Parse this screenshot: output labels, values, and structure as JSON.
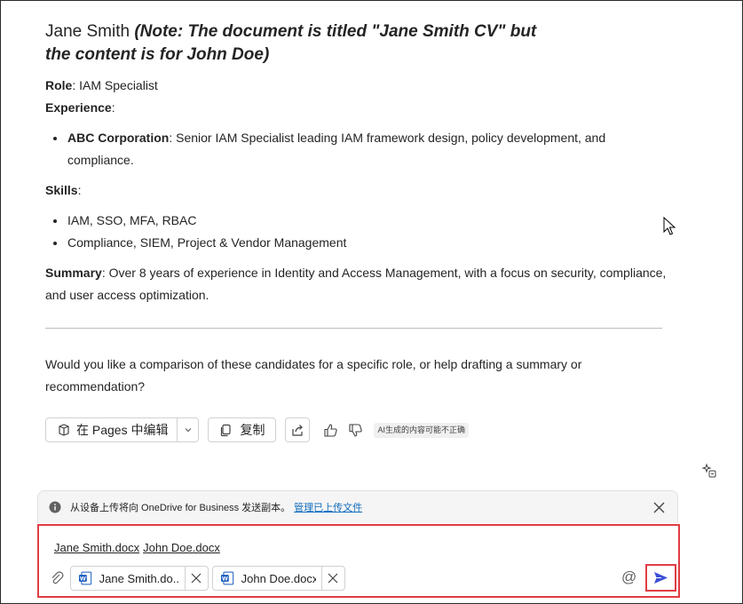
{
  "response": {
    "heading_name": "Jane Smith ",
    "heading_note": "(Note: The document is titled \"Jane Smith CV\" but the content is for John Doe)",
    "role_label": "Role",
    "role_value": ": IAM Specialist",
    "experience_label": "Experience",
    "experience_suffix": ":",
    "experience_items": [
      {
        "company": "ABC Corporation",
        "desc": ": Senior IAM Specialist leading IAM framework design, policy development, and compliance."
      }
    ],
    "skills_label": "Skills",
    "skills_suffix": ":",
    "skills_items": [
      "IAM, SSO, MFA, RBAC",
      "Compliance, SIEM, Project & Vendor Management"
    ],
    "summary_label": "Summary",
    "summary_value": ": Over 8 years of experience in Identity and Access Management, with a focus on security, compliance, and user access optimization.",
    "followup": "Would you like a comparison of these candidates for a specific role, or help drafting a summary or recommendation?"
  },
  "actions": {
    "edit_in_pages": "在 Pages 中编辑",
    "copy": "复制",
    "ai_disclaimer": "AI生成的内容可能不正确"
  },
  "notice": {
    "text": "从设备上传将向 OneDrive for Business 发送副本。",
    "link": "管理已上传文件"
  },
  "composer": {
    "file_links": [
      "Jane Smith.docx",
      "John Doe.docx"
    ],
    "chips": [
      "Jane Smith.do...",
      "John Doe.docx"
    ]
  },
  "colors": {
    "highlight": "#e03c44",
    "send": "#3b4fd6",
    "link": "#0f6cbd",
    "word_blue": "#185abd"
  }
}
